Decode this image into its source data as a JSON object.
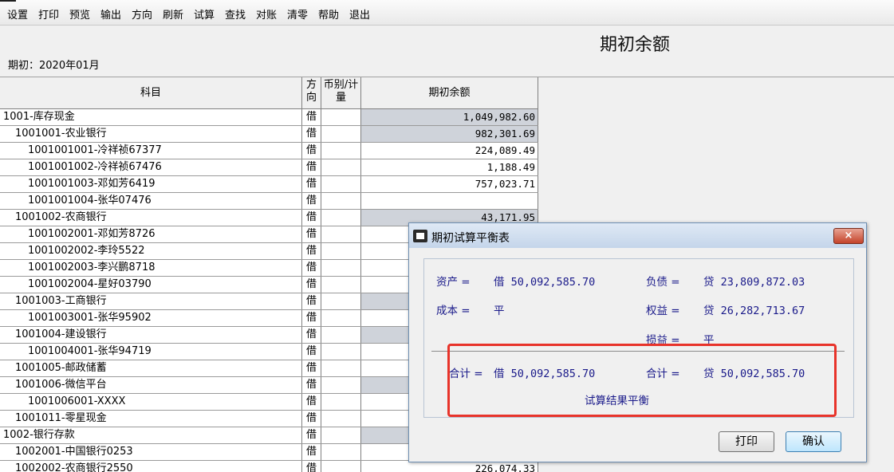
{
  "toolbar": {
    "items": [
      "设置",
      "打印",
      "预览",
      "输出",
      "方向",
      "刷新",
      "试算",
      "查找",
      "对账",
      "清零",
      "帮助",
      "退出"
    ]
  },
  "header": {
    "title": "期初余额",
    "period": "期初：2020年01月"
  },
  "grid": {
    "columns": {
      "subject": "科目",
      "direction": "方向",
      "currency": "币别/计量",
      "amount": "期初余额"
    },
    "rows": [
      {
        "name": "1001-库存现金",
        "indent": 0,
        "dir": "借",
        "amount": "1,049,982.60",
        "shaded": true
      },
      {
        "name": "1001001-农业银行",
        "indent": 1,
        "dir": "借",
        "amount": "982,301.69",
        "shaded": true
      },
      {
        "name": "1001001001-冷祥祯67377",
        "indent": 2,
        "dir": "借",
        "amount": "224,089.49",
        "shaded": false
      },
      {
        "name": "1001001002-冷祥祯67476",
        "indent": 2,
        "dir": "借",
        "amount": "1,188.49",
        "shaded": false
      },
      {
        "name": "1001001003-邓如芳6419",
        "indent": 2,
        "dir": "借",
        "amount": "757,023.71",
        "shaded": false
      },
      {
        "name": "1001001004-张华07476",
        "indent": 2,
        "dir": "借",
        "amount": "",
        "shaded": false
      },
      {
        "name": "1001002-农商银行",
        "indent": 1,
        "dir": "借",
        "amount": "43,171.95",
        "shaded": true
      },
      {
        "name": "1001002001-邓如芳8726",
        "indent": 2,
        "dir": "借",
        "amount": "",
        "shaded": false
      },
      {
        "name": "1001002002-李玲5522",
        "indent": 2,
        "dir": "借",
        "amount": "",
        "shaded": false
      },
      {
        "name": "1001002003-李兴鹏8718",
        "indent": 2,
        "dir": "借",
        "amount": "",
        "shaded": false
      },
      {
        "name": "1001002004-星好03790",
        "indent": 2,
        "dir": "借",
        "amount": "",
        "shaded": false
      },
      {
        "name": "1001003-工商银行",
        "indent": 1,
        "dir": "借",
        "amount": "",
        "shaded": true
      },
      {
        "name": "1001003001-张华95902",
        "indent": 2,
        "dir": "借",
        "amount": "",
        "shaded": false
      },
      {
        "name": "1001004-建设银行",
        "indent": 1,
        "dir": "借",
        "amount": "",
        "shaded": true
      },
      {
        "name": "1001004001-张华94719",
        "indent": 2,
        "dir": "借",
        "amount": "",
        "shaded": false
      },
      {
        "name": "1001005-邮政储蓄",
        "indent": 1,
        "dir": "借",
        "amount": "",
        "shaded": false
      },
      {
        "name": "1001006-微信平台",
        "indent": 1,
        "dir": "借",
        "amount": "",
        "shaded": true
      },
      {
        "name": "1001006001-XXXX",
        "indent": 2,
        "dir": "借",
        "amount": "",
        "shaded": false
      },
      {
        "name": "1001011-零星现金",
        "indent": 1,
        "dir": "借",
        "amount": "",
        "shaded": false
      },
      {
        "name": "1002-银行存款",
        "indent": 0,
        "dir": "借",
        "amount": "",
        "shaded": true
      },
      {
        "name": "1002001-中国银行0253",
        "indent": 1,
        "dir": "借",
        "amount": "",
        "shaded": false
      },
      {
        "name": "1002002-农商银行2550",
        "indent": 1,
        "dir": "借",
        "amount": "226,074.33",
        "shaded": false
      }
    ]
  },
  "dialog": {
    "title": "期初试算平衡表",
    "close": "×",
    "asset_label": "资产 =",
    "asset_value": "借 50,092,585.70",
    "liability_label": "负债 =",
    "liability_value": "贷 23,809,872.03",
    "cost_label": "成本 =",
    "cost_value": "平",
    "equity_label": "权益 =",
    "equity_value": "贷 26,282,713.67",
    "pl_label": "损益 =",
    "pl_value": "平",
    "total_left_label": "合计 =",
    "total_left_value": "借 50,092,585.70",
    "total_right_label": "合计 =",
    "total_right_value": "贷 50,092,585.70",
    "result": "试算结果平衡",
    "print_button": "打印",
    "ok_button": "确认"
  },
  "colors": {
    "shaded_cell": "#cfd3da",
    "highlight_box": "#e8332a",
    "dialog_text": "#1a1a8a"
  }
}
